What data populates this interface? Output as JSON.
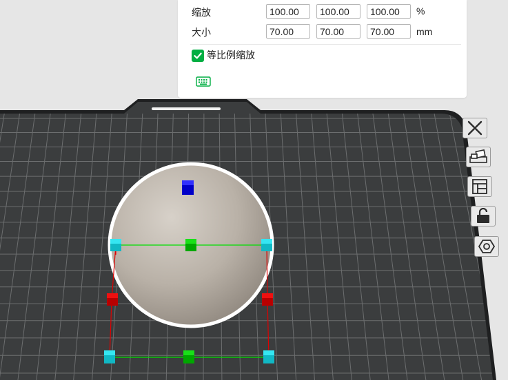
{
  "scale_panel": {
    "scale_label": "缩放",
    "size_label": "大小",
    "scale": {
      "x": "100.00",
      "y": "100.00",
      "z": "100.00",
      "unit": "%"
    },
    "size": {
      "x": "70.00",
      "y": "70.00",
      "z": "70.00",
      "unit": "mm"
    },
    "uniform_scale_label": "等比例缩放",
    "uniform_scale_checked": true,
    "keyboard_icon": "keyboard-icon"
  },
  "toolbar": {
    "icons": [
      "close-icon",
      "arrange-icon",
      "layout-icon",
      "lock-icon",
      "hexagon-icon"
    ]
  },
  "colors": {
    "accent": "#00ae42",
    "plate": "#3b3d3e",
    "grid": "#6c6e6f",
    "bed_edge": "#1f2021",
    "handle_cyan": "#1fd4e0",
    "handle_green": "#00c800",
    "handle_red": "#d40000",
    "handle_blue": "#0000c8"
  }
}
